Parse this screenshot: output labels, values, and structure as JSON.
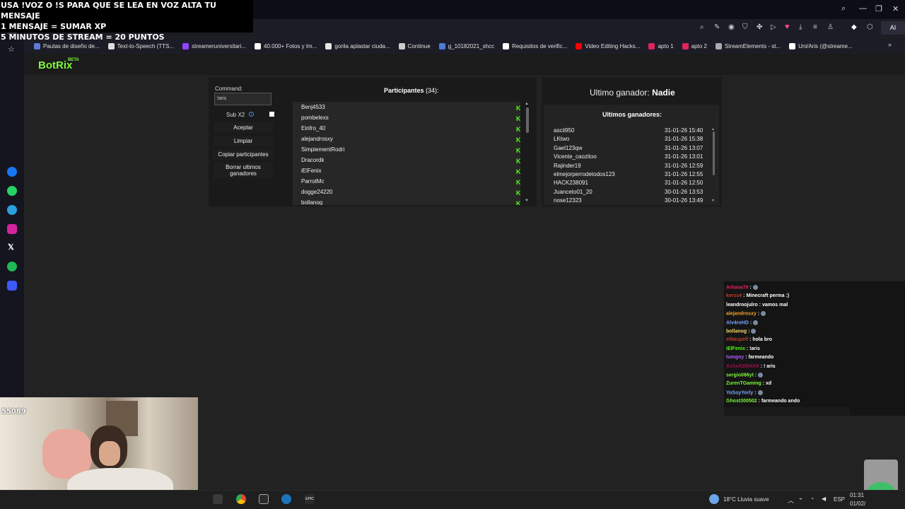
{
  "overlay": {
    "line1": "USA !VOZ O !S PARA QUE SE LEA EN VOZ ALTA TU MENSAJE",
    "line2": "1 MENSAJE = SUMAR XP",
    "line3": "5 MINUTOS DE STREAM = 20 PUNTOS"
  },
  "window": {
    "minimize": "—",
    "maximize": "❐",
    "close": "✕"
  },
  "toolbar": {
    "ai_label": "AI"
  },
  "bookmarks": [
    {
      "label": "Pautas de diseño de...",
      "color": "#5b7bd5"
    },
    {
      "label": "Text-to-Speech (TTS...",
      "color": "#dddddd"
    },
    {
      "label": "streameruniversitari...",
      "color": "#9146ff"
    },
    {
      "label": "40.000+ Fotos y Im...",
      "color": "#ffffff"
    },
    {
      "label": "gorila aplastar ciuda...",
      "color": "#e6e6e6"
    },
    {
      "label": "Continue",
      "color": "#cccccc"
    },
    {
      "label": "g_10182021_shcc",
      "color": "#4a7bd9"
    },
    {
      "label": "Requisitos de verific...",
      "color": "#ffffff"
    },
    {
      "label": "Video Editing Hacks...",
      "color": "#ff0000"
    },
    {
      "label": "apto 1",
      "color": "#e0245e"
    },
    {
      "label": "apto 2",
      "color": "#e0245e"
    },
    {
      "label": "StreamElements - st...",
      "color": "#aaaaaa"
    },
    {
      "label": "Uni/Aris (@streame...",
      "color": "#ffffff"
    }
  ],
  "botrix": {
    "logo": "BotRix",
    "beta": "BETA",
    "command_label": "Command:",
    "command_value": "!aris",
    "sub_label": "Sub X2",
    "buttons": {
      "accept": "Aceptar",
      "clear": "Limpiar",
      "copy": "Copiar participantes",
      "delete_line1": "Borrar ultimos",
      "delete_line2": "ganadores"
    },
    "participants_title": "Participantes",
    "participants_count": "(34):",
    "participants": [
      "Benj4533",
      "pombelexs",
      "Einfro_40",
      "alejandrosxy",
      "SimpiementRodri",
      "Dracordk",
      "iElFenix",
      "ParrotMc",
      "dogge24220",
      "bollanog"
    ],
    "last_winner_label": "Ultimo ganador:",
    "last_winner_value": "Nadie",
    "winners_title": "Ultimos ganadores:",
    "winners": [
      {
        "name": "ascii950",
        "date": "31-01-26 15:40"
      },
      {
        "name": "LKtwo",
        "date": "31-01-26 15:38"
      },
      {
        "name": "Gael123qw",
        "date": "31-01-26 13:07"
      },
      {
        "name": "Vicente_caozitoo",
        "date": "31-01-26 13:01"
      },
      {
        "name": "Rajinder19",
        "date": "31-01-26 12:59"
      },
      {
        "name": "elmejorperrodetodos123",
        "date": "31-01-26 12:55"
      },
      {
        "name": "HACK238091",
        "date": "31-01-26 12:50"
      },
      {
        "name": "Juanceto01_20",
        "date": "30-01-26 13:53"
      },
      {
        "name": "nose12323",
        "date": "30-01-26 13:49"
      }
    ]
  },
  "chat": [
    {
      "user": "Arkana79",
      "msg": "",
      "color": "#e0245e"
    },
    {
      "user": "kerss4",
      "msg": "Minecraft perma :)",
      "color": "#c0392b"
    },
    {
      "user": "leandroojulro",
      "msg": "vamos mal",
      "color": "#ffffff"
    },
    {
      "user": "alejandrosxy",
      "msg": "",
      "color": "#f0a030"
    },
    {
      "user": "Alv4roHD",
      "msg": "",
      "color": "#7aa7ff"
    },
    {
      "user": "bollanog",
      "msg": "",
      "color": "#f5d76e"
    },
    {
      "user": "elNaspelf",
      "msg": "hola bro",
      "color": "#c0392b"
    },
    {
      "user": "iElFenix",
      "msg": "!aris",
      "color": "#53fc18"
    },
    {
      "user": "tumgoy",
      "msg": "farmeando",
      "color": "#b05cff"
    },
    {
      "user": "XxXxX2004XX",
      "msg": "! aris",
      "color": "#a01050"
    },
    {
      "user": "sergio086yt",
      "msg": "",
      "color": "#7cf73a"
    },
    {
      "user": "ZurenTGaming",
      "msg": "xd",
      "color": "#7cf73a"
    },
    {
      "user": "YoSoyYorly",
      "msg": "",
      "color": "#7aa7ff"
    },
    {
      "user": "Ghost300502",
      "msg": "farmeando ando",
      "color": "#7cf73a"
    }
  ],
  "cam": {
    "counter": "55089"
  },
  "taskbar": {
    "weather": "18°C  Lluvia suave",
    "lang": "ESP",
    "time": "01:31",
    "date": "01/02/"
  }
}
